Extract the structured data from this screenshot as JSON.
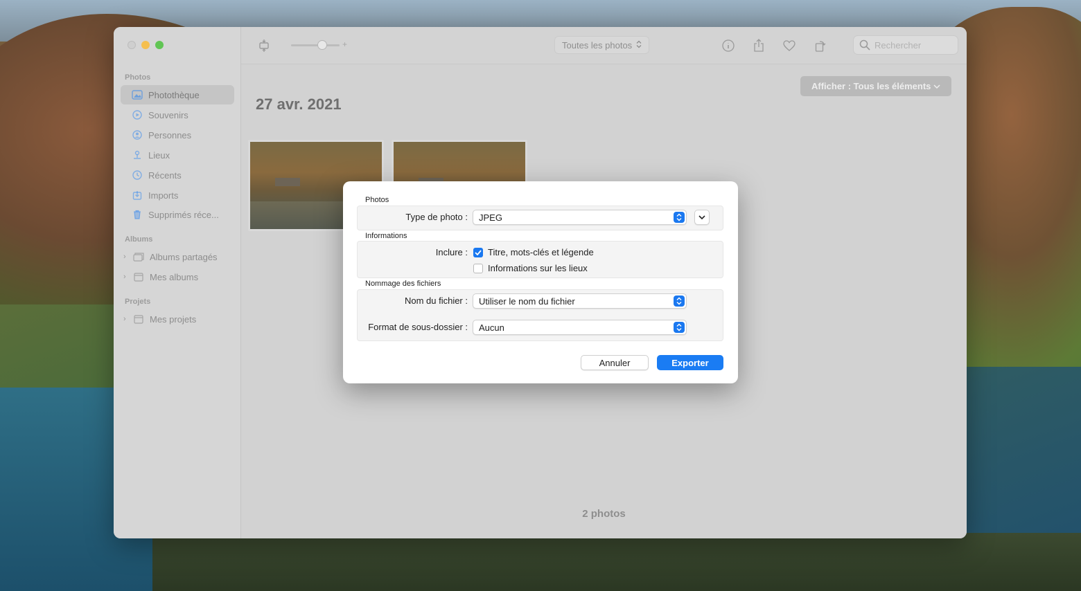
{
  "sidebar": {
    "sections": {
      "photos": "Photos",
      "albums": "Albums",
      "projects": "Projets"
    },
    "items": [
      {
        "label": "Photothèque",
        "icon": "photo-library-icon"
      },
      {
        "label": "Souvenirs",
        "icon": "memories-icon"
      },
      {
        "label": "Personnes",
        "icon": "people-icon"
      },
      {
        "label": "Lieux",
        "icon": "places-icon"
      },
      {
        "label": "Récents",
        "icon": "clock-icon"
      },
      {
        "label": "Imports",
        "icon": "imports-icon"
      },
      {
        "label": "Supprimés réce...",
        "icon": "trash-icon"
      }
    ],
    "album_items": [
      {
        "label": "Albums partagés",
        "icon": "shared-albums-icon"
      },
      {
        "label": "Mes albums",
        "icon": "folder-icon"
      }
    ],
    "project_items": [
      {
        "label": "Mes projets",
        "icon": "folder-icon"
      }
    ]
  },
  "toolbar": {
    "view_select": "Toutes les photos",
    "slider_plus": "+",
    "search_placeholder": "Rechercher"
  },
  "content": {
    "date_title": "27 avr. 2021",
    "filter_button": "Afficher : Tous les éléments",
    "photo_count": "2 photos"
  },
  "export_dialog": {
    "group_photos": "Photos",
    "photo_type_label": "Type de photo :",
    "photo_type_value": "JPEG",
    "group_info": "Informations",
    "include_label": "Inclure :",
    "include_title": "Titre, mots-clés et légende",
    "include_title_checked": true,
    "include_location": "Informations sur les lieux",
    "include_location_checked": false,
    "group_naming": "Nommage des fichiers",
    "filename_label": "Nom du fichier :",
    "filename_value": "Utiliser le nom du fichier",
    "subfolder_label": "Format de sous-dossier :",
    "subfolder_value": "Aucun",
    "cancel": "Annuler",
    "export": "Exporter"
  },
  "colors": {
    "accent": "#1a7cf3",
    "tl_min": "#f5bf4f",
    "tl_max": "#61c554"
  }
}
